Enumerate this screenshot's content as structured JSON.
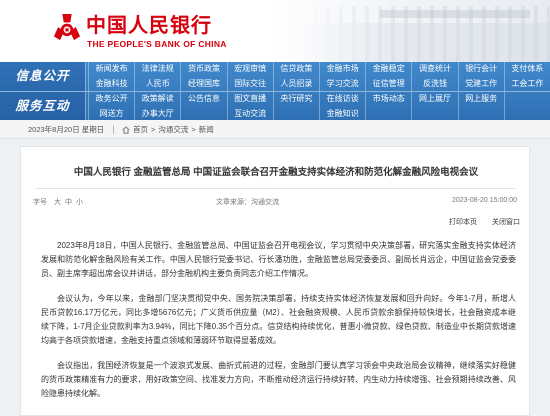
{
  "header": {
    "logo_cn": "中国人民银行",
    "logo_en": "THE PEOPLE'S BANK OF CHINA",
    "emblem_icon": "pboc-emblem-icon",
    "brand_color": "#d6000e"
  },
  "nav": {
    "bg_color": "#3a7cc0",
    "sections": [
      {
        "label": "信息公开",
        "rows": [
          [
            "新闻发布",
            "法律法规",
            "货币政策",
            "宏观审慎",
            "信贷政策",
            "金融市场",
            "金融稳定",
            "调查统计",
            "银行会计",
            "支付体系"
          ],
          [
            "金融科技",
            "人民币",
            "经理国库",
            "国际交往",
            "人员招录",
            "学习交流",
            "征信管理",
            "反洗钱",
            "党建工作",
            "工会工作"
          ]
        ]
      },
      {
        "label": "服务互动",
        "rows": [
          [
            "政务公开",
            "政策解读",
            "公告信息",
            "图文直播",
            "央行研究",
            "在线访谈",
            "市场动态",
            "网上展厅",
            "网上服务",
            ""
          ],
          [
            "网送方",
            "办事大厅",
            "",
            "互动交流",
            "",
            "金融知识",
            "",
            "",
            "",
            ""
          ]
        ]
      }
    ]
  },
  "breadcrumb": {
    "date": "2023年8月20日 星期日",
    "home_icon": "home-icon",
    "separator": ">",
    "items": [
      "首页",
      "沟通交流",
      "新闻"
    ]
  },
  "article": {
    "title": "中国人民银行 金融监管总局 中国证监会联合召开金融支持实体经济和防范化解金融风险电视会议",
    "font_size_label": "字号",
    "font_size_options": [
      "大",
      "中",
      "小"
    ],
    "source": "文章来源：沟通交流",
    "date": "2023-08-20 15:00:00",
    "print_label": "打印本页",
    "close_label": "关闭窗口",
    "paragraphs": [
      "2023年8月18日，中国人民银行、金融监管总局、中国证监会召开电视会议，学习贯彻中央决策部署，研究落实金融支持实体经济发展和防范化解金融风险有关工作。中国人民银行党委书记、行长潘功胜，金融监管总局党委委员、副局长肖远企，中国证监会党委委员、副主席李超出席会议并讲话，部分金融机构主要负责同志介绍工作情况。",
      "会议认为，今年以来，金融部门坚决贯彻党中央、国务院决策部署，持续支持实体经济恢复发展和回升向好。今年1-7月，新增人民币贷款16.17万亿元，同比多增5676亿元；广义货币供应量（M2）、社会融资规模、人民币贷款余额保持较快增长，社会融资成本继续下降，1-7月企业贷款利率为3.94%，同比下降0.35个百分点。信贷结构持续优化，普惠小微贷款、绿色贷款、制造业中长期贷款增速均高于各项贷款增速，金融支持重点领域和薄弱环节取得显著成效。",
      "会议指出，我国经济恢复是一个波浪式发展、曲折式前进的过程，金融部门要认真学习领会中央政治局会议精神，继续落实好稳健的货币政策精准有力的要求，用好政策空间、找准发力方向，不断推动经济运行持续好转、内生动力持续增强、社会预期持续改善、风险隐患持续化解。"
    ]
  }
}
